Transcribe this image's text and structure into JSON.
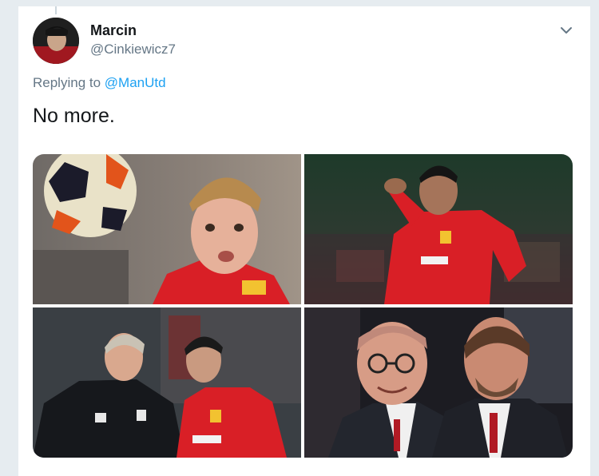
{
  "tweet": {
    "author_name": "Marcin",
    "author_handle": "@Cinkiewicz7",
    "replying_prefix": "Replying to",
    "replying_to": "@ManUtd",
    "text": "No more."
  },
  "icons": {
    "menu": "chevron-down-icon"
  },
  "colors": {
    "text_primary": "#14171a",
    "text_secondary": "#657786",
    "link": "#1da1f2",
    "kit_red": "#d91f26"
  },
  "media": {
    "photos": [
      {
        "subject": "player-with-football"
      },
      {
        "subject": "player-saluting"
      },
      {
        "subject": "coach-and-player"
      },
      {
        "subject": "two-men-in-stands"
      }
    ]
  }
}
